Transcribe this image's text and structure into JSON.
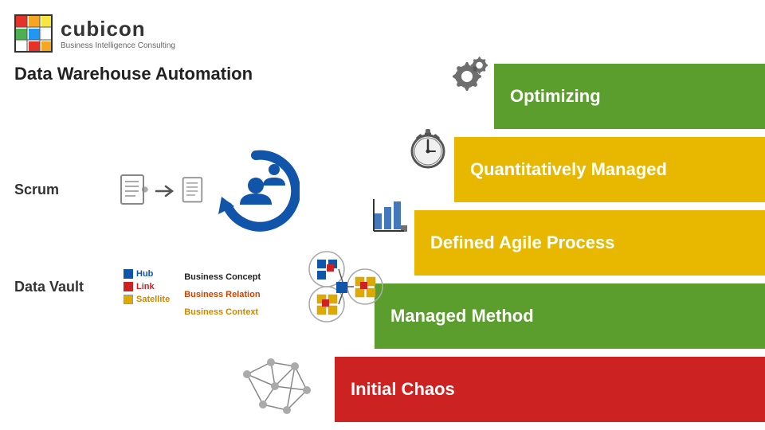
{
  "logo": {
    "title": "cubicon",
    "subtitle": "Business Intelligence Consulting"
  },
  "page_title": "Data Warehouse Automation",
  "bars": [
    {
      "id": "bar5",
      "label": "Optimizing",
      "color": "#3a9e2e"
    },
    {
      "id": "bar4",
      "label": "Quantitatively Managed",
      "color": "#d4a800"
    },
    {
      "id": "bar3",
      "label": "Defined Agile Process",
      "color": "#d4a800"
    },
    {
      "id": "bar2",
      "label": "Managed Method",
      "color": "#3a9e2e"
    },
    {
      "id": "bar1",
      "label": "Initial Chaos",
      "color": "#bb1111"
    }
  ],
  "left_labels": [
    "Scrum",
    "Data Vault"
  ],
  "legend": {
    "items": [
      {
        "color": "#1155aa",
        "shape": "square",
        "label": "Hub"
      },
      {
        "color": "#cc2222",
        "shape": "square",
        "label": "Link"
      },
      {
        "color": "#ddaa00",
        "shape": "square",
        "label": "Satellite"
      }
    ],
    "concepts": [
      {
        "color": "#222",
        "label": "Business Concept"
      },
      {
        "color": "#cc4400",
        "label": "Business Relation"
      },
      {
        "color": "#cc8800",
        "label": "Business Context"
      }
    ]
  }
}
